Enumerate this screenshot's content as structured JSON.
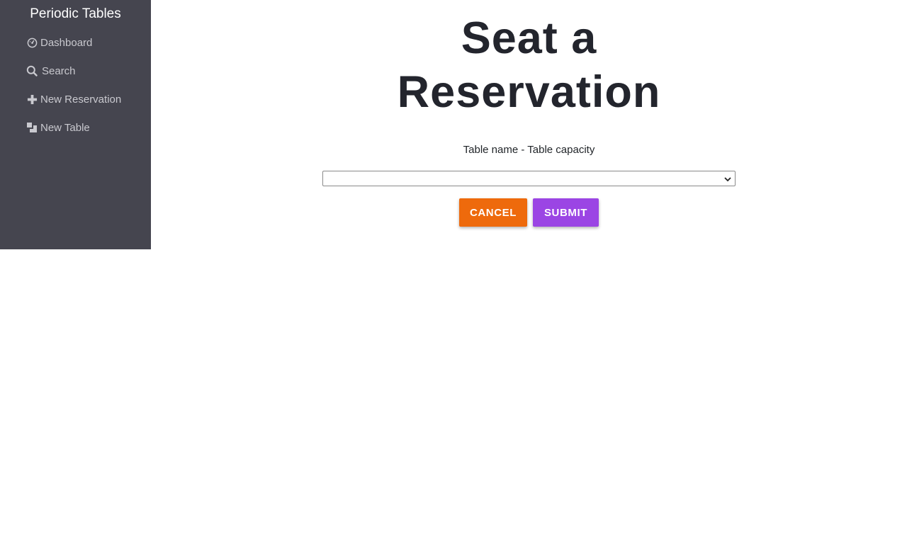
{
  "sidebar": {
    "brand": "Periodic Tables",
    "items": [
      {
        "label": "Dashboard",
        "icon": "dashboard-icon"
      },
      {
        "label": "Search",
        "icon": "search-icon"
      },
      {
        "label": "New Reservation",
        "icon": "plus-icon"
      },
      {
        "label": "New Table",
        "icon": "table-icon"
      }
    ]
  },
  "main": {
    "title_line1": "Seat a",
    "title_line2": "Reservation",
    "field_label": "Table name - Table capacity",
    "select_value": "",
    "cancel_label": "CANCEL",
    "submit_label": "SUBMIT"
  },
  "colors": {
    "sidebar_bg": "#45454f",
    "cancel": "#ee6a0c",
    "submit": "#9b45e4",
    "title": "#23252d"
  }
}
